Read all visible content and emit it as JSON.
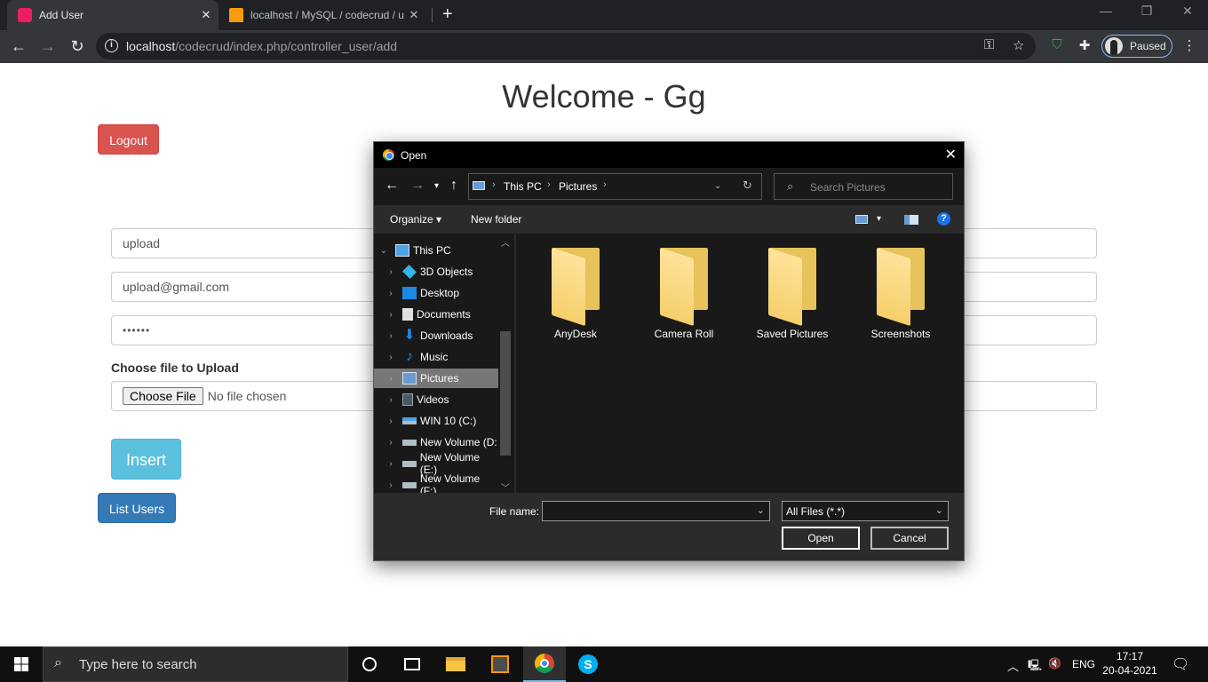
{
  "browser": {
    "tabs": [
      {
        "title": "Add User",
        "favicon_color": "#e91e63"
      },
      {
        "title": "localhost / MySQL / codecrud / u",
        "favicon_color": "#f89c0e"
      }
    ],
    "url_host": "localhost",
    "url_path": "/codecrud/index.php/controller_user/add",
    "profile_label": "Paused"
  },
  "page": {
    "title": "Welcome - Gg",
    "logout_label": "Logout",
    "fields": {
      "name": "upload",
      "email": "upload@gmail.com",
      "password": "••••••"
    },
    "file_label": "Choose file to Upload",
    "choose_file": "Choose File",
    "no_file": "No file chosen",
    "insert_label": "Insert",
    "list_users_label": "List Users",
    "colors": {
      "logout": "#d9534f",
      "insert": "#5bc0de",
      "list": "#337ab7"
    }
  },
  "dialog": {
    "title": "Open",
    "breadcrumb": [
      "This PC",
      "Pictures"
    ],
    "search_placeholder": "Search Pictures",
    "organize": "Organize ▾",
    "new_folder": "New folder",
    "help": "?",
    "tree": [
      {
        "label": "This PC",
        "icon": "pc-icon"
      },
      {
        "label": "3D Objects",
        "icon": "cube-icon"
      },
      {
        "label": "Desktop",
        "icon": "desktop-icon"
      },
      {
        "label": "Documents",
        "icon": "document-icon"
      },
      {
        "label": "Downloads",
        "icon": "download-icon"
      },
      {
        "label": "Music",
        "icon": "music-icon"
      },
      {
        "label": "Pictures",
        "icon": "pictures-icon"
      },
      {
        "label": "Videos",
        "icon": "video-icon"
      },
      {
        "label": "WIN 10 (C:)",
        "icon": "drive-icon"
      },
      {
        "label": "New Volume (D:",
        "icon": "drive-icon"
      },
      {
        "label": "New Volume (E:)",
        "icon": "drive-icon"
      },
      {
        "label": "New Volume (F:)",
        "icon": "drive-icon"
      }
    ],
    "folders": [
      "AnyDesk",
      "Camera Roll",
      "Saved Pictures",
      "Screenshots"
    ],
    "file_name_label": "File name:",
    "file_name_value": "",
    "file_type": "All Files (*.*)",
    "open_label": "Open",
    "cancel_label": "Cancel"
  },
  "taskbar": {
    "search_placeholder": "Type here to search",
    "language": "ENG",
    "time": "17:17",
    "date": "20-04-2021"
  }
}
